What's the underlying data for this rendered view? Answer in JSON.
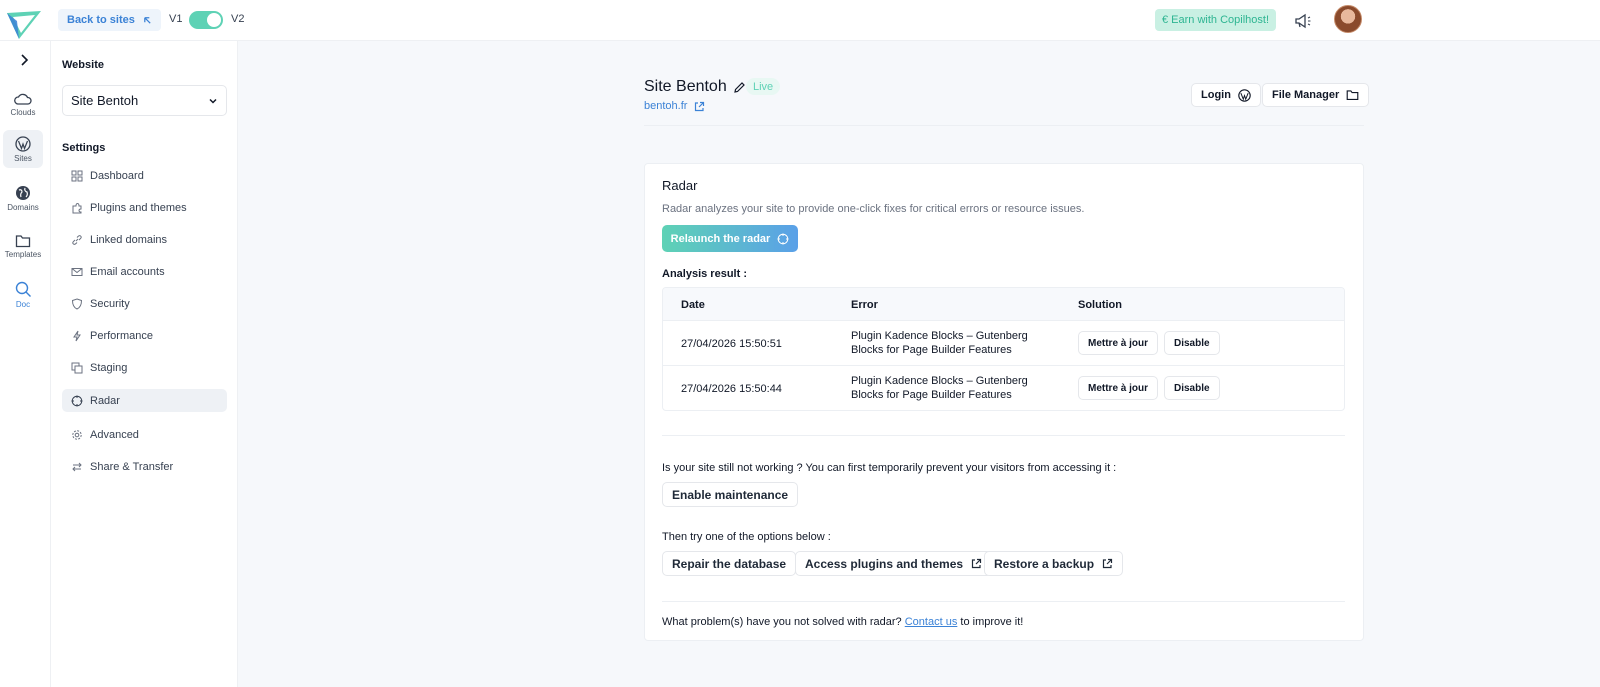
{
  "topbar": {
    "back_label": "Back to sites",
    "v1": "V1",
    "v2": "V2",
    "earn_label": "€ Earn with Copilhost!"
  },
  "rail": {
    "items": [
      {
        "label": "Clouds",
        "icon": "cloud-icon"
      },
      {
        "label": "Sites",
        "icon": "wordpress-icon"
      },
      {
        "label": "Domains",
        "icon": "globe-icon"
      },
      {
        "label": "Templates",
        "icon": "folder-icon"
      },
      {
        "label": "Doc",
        "icon": "search-icon"
      }
    ]
  },
  "sidebar": {
    "website_heading": "Website",
    "site_selected": "Site Bentoh",
    "settings_heading": "Settings",
    "items": [
      {
        "label": "Dashboard",
        "icon": "dashboard-icon"
      },
      {
        "label": "Plugins and themes",
        "icon": "puzzle-icon"
      },
      {
        "label": "Linked domains",
        "icon": "link-icon"
      },
      {
        "label": "Email accounts",
        "icon": "mail-icon"
      },
      {
        "label": "Security",
        "icon": "shield-icon"
      },
      {
        "label": "Performance",
        "icon": "bolt-icon"
      },
      {
        "label": "Staging",
        "icon": "copy-icon"
      },
      {
        "label": "Radar",
        "icon": "radar-icon"
      },
      {
        "label": "Advanced",
        "icon": "gear-icon"
      },
      {
        "label": "Share & Transfer",
        "icon": "transfer-icon"
      }
    ],
    "active": "Radar"
  },
  "site": {
    "title": "Site Bentoh",
    "status": "Live",
    "url": "bentoh.fr",
    "login_label": "Login",
    "file_manager_label": "File Manager"
  },
  "radar": {
    "title": "Radar",
    "description": "Radar analyzes your site to provide one-click fixes for critical errors or resource issues.",
    "relaunch_label": "Relaunch the radar",
    "analysis_label": "Analysis result :",
    "columns": {
      "date": "Date",
      "error": "Error",
      "solution": "Solution"
    },
    "rows": [
      {
        "date": "27/04/2026 15:50:51",
        "error_line1": "Plugin Kadence Blocks – Gutenberg",
        "error_line2": "Blocks for Page Builder Features",
        "update_label": "Mettre à jour",
        "disable_label": "Disable"
      },
      {
        "date": "27/04/2026 15:50:44",
        "error_line1": "Plugin Kadence Blocks – Gutenberg",
        "error_line2": "Blocks for Page Builder Features",
        "update_label": "Mettre à jour",
        "disable_label": "Disable"
      }
    ],
    "maintenance_question": "Is your site still not working ? You can first temporarily prevent your visitors from accessing it :",
    "maintenance_label": "Enable maintenance",
    "options_text": "Then try one of the options below :",
    "repair_label": "Repair the database",
    "access_plugins_label": "Access plugins and themes",
    "restore_label": "Restore a backup",
    "footer_prefix": "What problem(s) have you not solved with radar?",
    "footer_link": "Contact us",
    "footer_suffix": "to improve it!"
  },
  "colors": {
    "accent": "#5ed2b5",
    "link": "#3b82d6",
    "background": "#f6f8fb"
  }
}
